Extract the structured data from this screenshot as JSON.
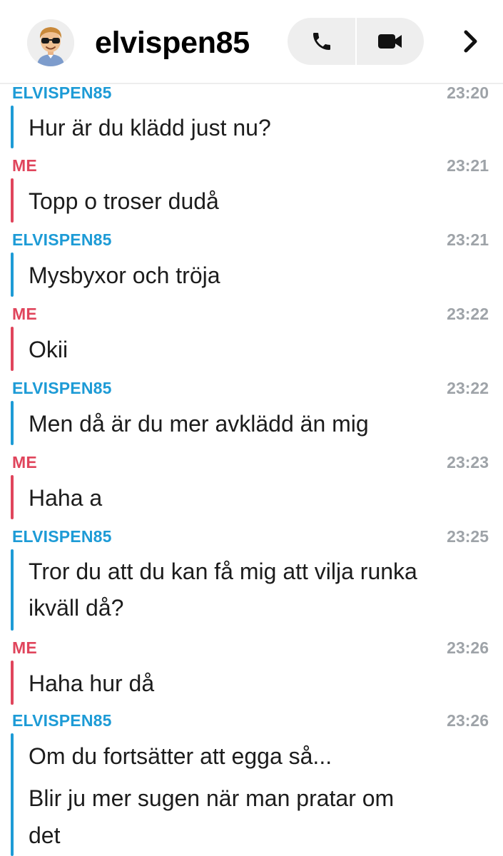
{
  "header": {
    "title": "elvispen85",
    "avatar_icon": "bitmoji-avatar",
    "call_icon": "phone-icon",
    "video_icon": "video-camera-icon",
    "more_icon": "chevron-right-icon"
  },
  "colors": {
    "them": "#1d9bd6",
    "me": "#e0455c",
    "timestamp": "#9ea3a8",
    "pill": "#eeeeee"
  },
  "messages": [
    {
      "sender": "ELVISPEN85",
      "time": "23:20",
      "lines": [
        "Hur är du klädd just nu?"
      ]
    },
    {
      "sender": "ME",
      "time": "23:21",
      "lines": [
        "Topp o troser dudå"
      ]
    },
    {
      "sender": "ELVISPEN85",
      "time": "23:21",
      "lines": [
        "Mysbyxor och tröja"
      ]
    },
    {
      "sender": "ME",
      "time": "23:22",
      "lines": [
        "Okii"
      ]
    },
    {
      "sender": "ELVISPEN85",
      "time": "23:22",
      "lines": [
        "Men då är du mer avklädd än mig"
      ]
    },
    {
      "sender": "ME",
      "time": "23:23",
      "lines": [
        "Haha a"
      ]
    },
    {
      "sender": "ELVISPEN85",
      "time": "23:25",
      "lines": [
        "Tror du att du kan få mig att vilja runka",
        "ikväll då?"
      ]
    },
    {
      "sender": "ME",
      "time": "23:26",
      "lines": [
        "Haha hur då"
      ]
    },
    {
      "sender": "ELVISPEN85",
      "time": "23:26",
      "lines": [
        "Om du fortsätter att egga så...",
        "Blir ju mer sugen när man pratar om",
        "det"
      ]
    }
  ]
}
